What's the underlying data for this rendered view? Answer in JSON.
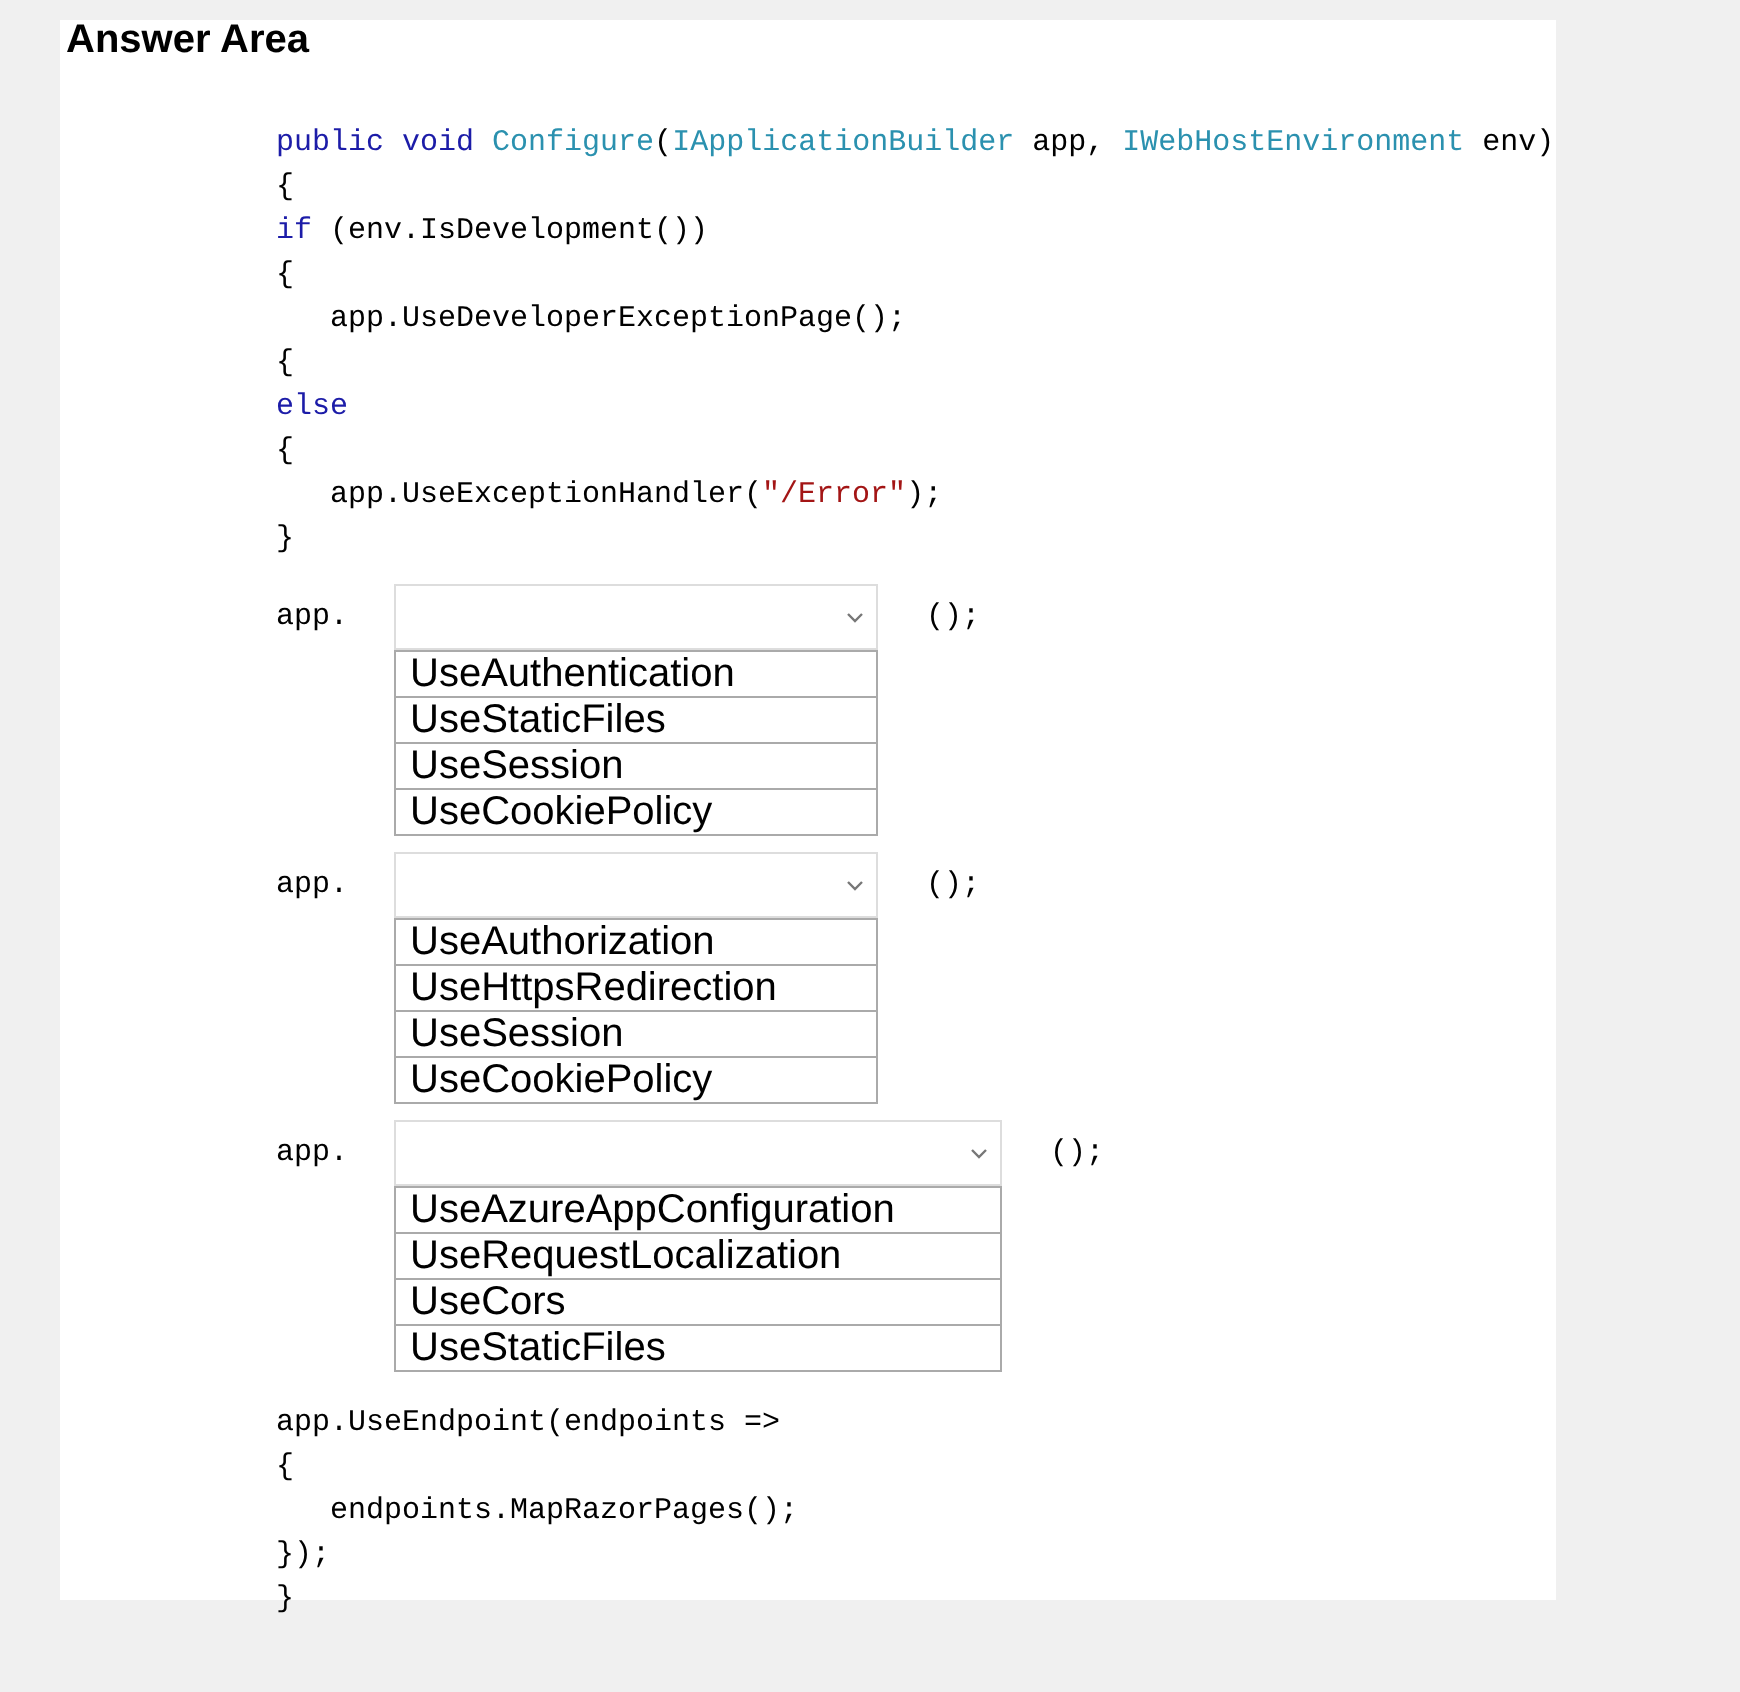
{
  "title": "Answer Area",
  "code_before": [
    {
      "tokens": [
        {
          "text": "public void ",
          "kind": "keyword"
        },
        {
          "text": "Configure",
          "kind": "type"
        },
        {
          "text": "(",
          "kind": "plain"
        },
        {
          "text": "IApplicationBuilder",
          "kind": "type"
        },
        {
          "text": " app, ",
          "kind": "plain"
        },
        {
          "text": "IWebHostEnvironment",
          "kind": "type"
        },
        {
          "text": " env)",
          "kind": "plain"
        }
      ]
    },
    {
      "tokens": [
        {
          "text": "{",
          "kind": "plain"
        }
      ]
    },
    {
      "tokens": [
        {
          "text": "if",
          "kind": "keyword"
        },
        {
          "text": " (env.IsDevelopment())",
          "kind": "plain"
        }
      ]
    },
    {
      "tokens": [
        {
          "text": "{",
          "kind": "plain"
        }
      ]
    },
    {
      "tokens": [
        {
          "text": "   app.UseDeveloperExceptionPage();",
          "kind": "plain"
        }
      ]
    },
    {
      "tokens": [
        {
          "text": "{",
          "kind": "plain"
        }
      ]
    },
    {
      "tokens": [
        {
          "text": "else",
          "kind": "keyword"
        }
      ]
    },
    {
      "tokens": [
        {
          "text": "{",
          "kind": "plain"
        }
      ]
    },
    {
      "tokens": [
        {
          "text": "   app.UseExceptionHandler(",
          "kind": "plain"
        },
        {
          "text": "\"/Error\"",
          "kind": "string"
        },
        {
          "text": ");",
          "kind": "plain"
        }
      ]
    },
    {
      "tokens": [
        {
          "text": "}",
          "kind": "plain"
        }
      ]
    }
  ],
  "blanks": [
    {
      "prefix": "app.",
      "suffix": "();",
      "options": [
        "UseAuthentication",
        "UseStaticFiles",
        "UseSession",
        "UseCookiePolicy"
      ]
    },
    {
      "prefix": "app.",
      "suffix": "();",
      "options": [
        "UseAuthorization",
        "UseHttpsRedirection",
        "UseSession",
        "UseCookiePolicy"
      ]
    },
    {
      "prefix": "app.",
      "suffix": "();",
      "options": [
        "UseAzureAppConfiguration",
        "UseRequestLocalization",
        "UseCors",
        "UseStaticFiles"
      ]
    }
  ],
  "code_after": [
    {
      "tokens": [
        {
          "text": "app.UseEndpoint(endpoints =>",
          "kind": "plain"
        }
      ]
    },
    {
      "tokens": [
        {
          "text": "{",
          "kind": "plain"
        }
      ]
    },
    {
      "tokens": [
        {
          "text": "   endpoints.MapRazorPages();",
          "kind": "plain"
        }
      ]
    },
    {
      "tokens": [
        {
          "text": "});",
          "kind": "plain"
        }
      ]
    },
    {
      "tokens": [
        {
          "text": "}",
          "kind": "plain"
        }
      ]
    }
  ]
}
